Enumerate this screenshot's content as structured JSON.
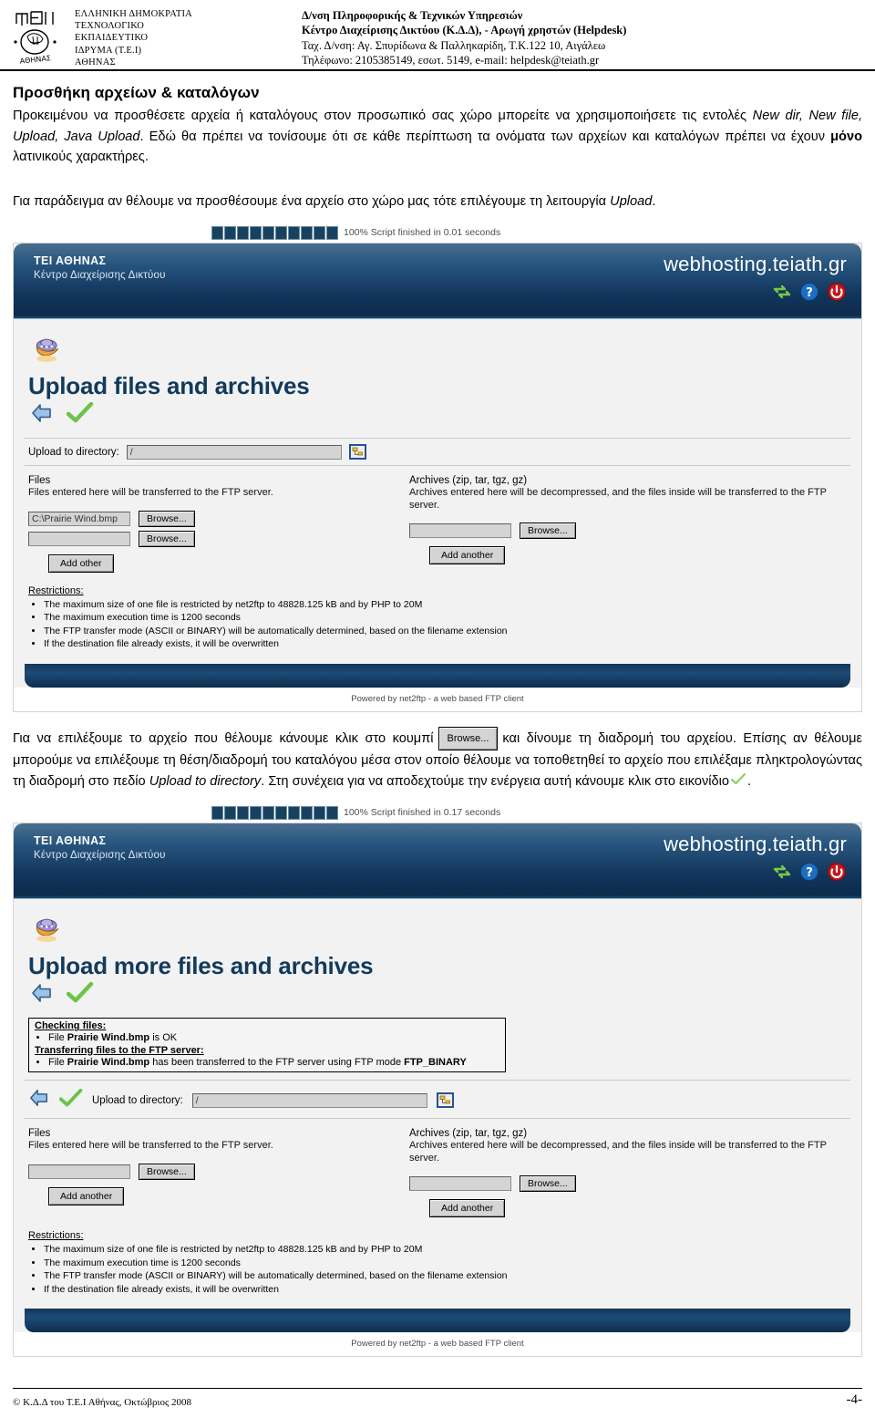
{
  "letterhead": {
    "logo_alt": "tei-athinas-logo",
    "left_lines": [
      "ΕΛΛΗΝΙΚΗ ΔΗΜΟΚΡΑΤΙΑ",
      "ΤΕΧΝΟΛΟΓΙΚΟ",
      "ΕΚΠΑΙΔΕΥΤΙΚΟ",
      "ΙΔΡΥΜΑ (Τ.Ε.Ι)",
      "ΑΘΗΝΑΣ"
    ],
    "right_lines": [
      "Δ/νση Πληροφορικής & Τεχνικών Υπηρεσιών",
      "Κέντρο Διαχείρισης Δικτύου (Κ.Δ.Δ), - Αρωγή χρηστών (Helpdesk)",
      "Ταχ. Δ/νση: Αγ. Σπυρίδωνα & Παλληκαρίδη, Τ.Κ.122 10, Αιγάλεω",
      "Τηλέφωνο: 2105385149, εσωτ. 5149,  e-mail: helpdesk@teiath.gr"
    ]
  },
  "doc": {
    "title": "Προσθήκη αρχείων & καταλόγων",
    "para1_a": "Προκειμένου να προσθέσετε αρχεία ή καταλόγους στον προσωπικό σας χώρο μπορείτε να χρησιμοποιήσετε τις εντολές ",
    "para1_cmds": "New dir, New file, Upload, Java Upload",
    "para1_b": ". Εδώ θα πρέπει να τονίσουμε ότι σε κάθε περίπτωση τα ονόματα των αρχείων και καταλόγων πρέπει να έχουν ",
    "para1_bold": "μόνο",
    "para1_c": " λατινικούς χαρακτήρες.",
    "para2_a": "Για παράδειγμα αν θέλουμε να προσθέσουμε ένα αρχείο στο χώρο μας τότε επιλέγουμε τη λειτουργία ",
    "para2_it": "Upload",
    "para2_b": ".",
    "para3_a": "Για να επιλέξουμε το αρχείο που θέλουμε κάνουμε κλικ στο κουμπί",
    "para3_btn": "Browse...",
    "para3_b": "και δίνουμε τη διαδρομή του αρχείου. Επίσης αν θέλουμε μπορούμε να επιλέξουμε τη θέση/διαδρομή του καταλόγου μέσα στον οποίο θέλουμε να τοποθετηθεί το αρχείο που επιλέξαμε πληκτρολογώντας τη διαδρομή στο πεδίο ",
    "para3_it": "Upload to directory",
    "para3_c": ". Στη συνέχεια για να αποδεχτούμε την ενέργεια αυτή κάνουμε κλικ στο εικονίδιο",
    "para3_d": "."
  },
  "shot1": {
    "progress": {
      "blocks": 10,
      "text": "100% Script finished in 0.01 seconds",
      "percent": "100%"
    },
    "header": {
      "org": "ΤΕΙ ΑΘΗΝΑΣ",
      "sub": "Κέντρο Διαχείρισης Δικτύου",
      "brand": "webhosting.teiath.gr",
      "icons": [
        "refresh-icon",
        "help-icon",
        "power-icon"
      ]
    },
    "page_title": "Upload files and archives",
    "upload_dir_label": "Upload to directory:",
    "upload_dir_value": "/",
    "files": {
      "title": "Files",
      "desc": "Files entered here will be transferred to the FTP server.",
      "rows": [
        {
          "value": "C:\\Prairie Wind.bmp",
          "browse": "Browse..."
        },
        {
          "value": "",
          "browse": "Browse..."
        }
      ],
      "add_label": "Add other"
    },
    "archives": {
      "title": "Archives (zip, tar, tgz, gz)",
      "desc": "Archives entered here will be decompressed, and the files inside will be transferred to the FTP server.",
      "rows": [
        {
          "value": "",
          "browse": "Browse..."
        }
      ],
      "add_label": "Add another"
    },
    "restrictions": {
      "heading": "Restrictions:",
      "items": [
        "The maximum size of one file is restricted by net2ftp to 48828.125 kB and by PHP to 20M",
        "The maximum execution time is 1200 seconds",
        "The FTP transfer mode (ASCII or BINARY) will be automatically determined, based on the filename extension",
        "If the destination file already exists, it will be overwritten"
      ]
    },
    "powered_by": "Powered by net2ftp - a web based FTP client"
  },
  "shot2": {
    "progress": {
      "blocks": 10,
      "text": "100% Script finished in 0.17 seconds",
      "percent": "100%"
    },
    "header": {
      "org": "ΤΕΙ ΑΘΗΝΑΣ",
      "sub": "Κέντρο Διαχείρισης Δικτύου",
      "brand": "webhosting.teiath.gr",
      "icons": [
        "refresh-icon",
        "help-icon",
        "power-icon"
      ]
    },
    "page_title": "Upload more files and archives",
    "status": {
      "checking_heading": "Checking files:",
      "checking_item_a": "File ",
      "checking_item_file": "Prairie Wind.bmp",
      "checking_item_b": " is OK",
      "transfer_heading": "Transferring files to the FTP server:",
      "transfer_item_a": "File ",
      "transfer_item_file": "Prairie Wind.bmp",
      "transfer_item_b": " has been transferred to the FTP server using FTP mode ",
      "transfer_mode": "FTP_BINARY"
    },
    "upload_dir_label": "Upload to directory:",
    "upload_dir_value": "/",
    "files": {
      "title": "Files",
      "desc": "Files entered here will be transferred to the FTP server.",
      "rows": [
        {
          "value": "",
          "browse": "Browse..."
        }
      ],
      "add_label": "Add another"
    },
    "archives": {
      "title": "Archives (zip, tar, tgz, gz)",
      "desc": "Archives entered here will be decompressed, and the files inside will be transferred to the FTP server.",
      "rows": [
        {
          "value": "",
          "browse": "Browse..."
        }
      ],
      "add_label": "Add another"
    },
    "restrictions": {
      "heading": "Restrictions:",
      "items": [
        "The maximum size of one file is restricted by net2ftp to 48828.125 kB and by PHP to 20M",
        "The maximum execution time is 1200 seconds",
        "The FTP transfer mode (ASCII or BINARY) will be automatically determined, based on the filename extension",
        "If the destination file already exists, it will be overwritten"
      ]
    },
    "powered_by": "Powered by net2ftp - a web based FTP client"
  },
  "footer": {
    "copyright": "© Κ.Δ.Δ του Τ.Ε.Ι Αθήνας, Οκτώβριος 2008",
    "page_number": "-4-"
  },
  "colors": {
    "header_blue_dark": "#0d2c4d",
    "header_blue_light": "#4a6f8f",
    "page_title": "#123a5c",
    "check_green": "#6cc24a",
    "power_red": "#c4161c",
    "help_blue": "#1a6fc4",
    "progress_block": "#17425f"
  }
}
